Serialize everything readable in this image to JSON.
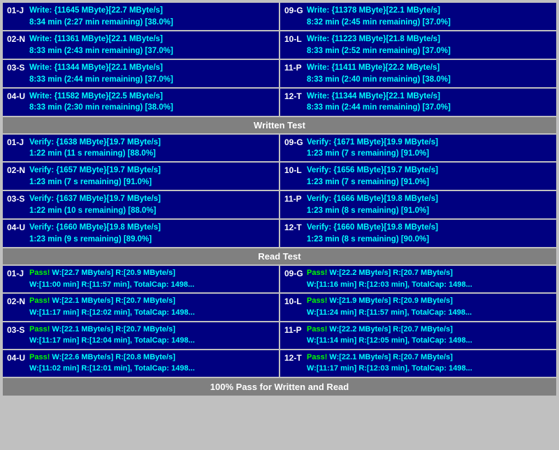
{
  "sections": {
    "write_test": {
      "header": "Written Test",
      "left_cells": [
        {
          "id": "01-J",
          "line1": "Write: {11645 MByte}[22.7 MByte/s]",
          "line2": "8:34 min (2:27 min remaining)  [38.0%]"
        },
        {
          "id": "02-N",
          "line1": "Write: {11361 MByte}[22.1 MByte/s]",
          "line2": "8:33 min (2:43 min remaining)  [37.0%]"
        },
        {
          "id": "03-S",
          "line1": "Write: {11344 MByte}[22.1 MByte/s]",
          "line2": "8:33 min (2:44 min remaining)  [37.0%]"
        },
        {
          "id": "04-U",
          "line1": "Write: {11582 MByte}[22.5 MByte/s]",
          "line2": "8:33 min (2:30 min remaining)  [38.0%]"
        }
      ],
      "right_cells": [
        {
          "id": "09-G",
          "line1": "Write: {11378 MByte}[22.1 MByte/s]",
          "line2": "8:32 min (2:45 min remaining)  [37.0%]"
        },
        {
          "id": "10-L",
          "line1": "Write: {11223 MByte}[21.8 MByte/s]",
          "line2": "8:33 min (2:52 min remaining)  [37.0%]"
        },
        {
          "id": "11-P",
          "line1": "Write: {11411 MByte}[22.2 MByte/s]",
          "line2": "8:33 min (2:40 min remaining)  [38.0%]"
        },
        {
          "id": "12-T",
          "line1": "Write: {11344 MByte}[22.1 MByte/s]",
          "line2": "8:33 min (2:44 min remaining)  [37.0%]"
        }
      ]
    },
    "verify_test": {
      "left_cells": [
        {
          "id": "01-J",
          "line1": "Verify: {1638 MByte}[19.7 MByte/s]",
          "line2": "1:22 min (11 s remaining)   [88.0%]"
        },
        {
          "id": "02-N",
          "line1": "Verify: {1657 MByte}[19.7 MByte/s]",
          "line2": "1:23 min (7 s remaining)   [91.0%]"
        },
        {
          "id": "03-S",
          "line1": "Verify: {1637 MByte}[19.7 MByte/s]",
          "line2": "1:22 min (10 s remaining)   [88.0%]"
        },
        {
          "id": "04-U",
          "line1": "Verify: {1660 MByte}[19.8 MByte/s]",
          "line2": "1:23 min (9 s remaining)   [89.0%]"
        }
      ],
      "right_cells": [
        {
          "id": "09-G",
          "line1": "Verify: {1671 MByte}[19.9 MByte/s]",
          "line2": "1:23 min (7 s remaining)   [91.0%]"
        },
        {
          "id": "10-L",
          "line1": "Verify: {1656 MByte}[19.7 MByte/s]",
          "line2": "1:23 min (7 s remaining)   [91.0%]"
        },
        {
          "id": "11-P",
          "line1": "Verify: {1666 MByte}[19.8 MByte/s]",
          "line2": "1:23 min (8 s remaining)   [91.0%]"
        },
        {
          "id": "12-T",
          "line1": "Verify: {1660 MByte}[19.8 MByte/s]",
          "line2": "1:23 min (8 s remaining)   [90.0%]"
        }
      ]
    },
    "read_test": {
      "header": "Read Test",
      "left_cells": [
        {
          "id": "01-J",
          "pass": "Pass!",
          "line1": "W:[22.7 MByte/s] R:[20.9 MByte/s]",
          "line2": "W:[11:00 min] R:[11:57 min], TotalCap: 1498..."
        },
        {
          "id": "02-N",
          "pass": "Pass!",
          "line1": "W:[22.1 MByte/s] R:[20.7 MByte/s]",
          "line2": "W:[11:17 min] R:[12:02 min], TotalCap: 1498..."
        },
        {
          "id": "03-S",
          "pass": "Pass!",
          "line1": "W:[22.1 MByte/s] R:[20.7 MByte/s]",
          "line2": "W:[11:17 min] R:[12:04 min], TotalCap: 1498..."
        },
        {
          "id": "04-U",
          "pass": "Pass!",
          "line1": "W:[22.6 MByte/s] R:[20.8 MByte/s]",
          "line2": "W:[11:02 min] R:[12:01 min], TotalCap: 1498..."
        }
      ],
      "right_cells": [
        {
          "id": "09-G",
          "pass": "Pass!",
          "line1": "W:[22.2 MByte/s] R:[20.7 MByte/s]",
          "line2": "W:[11:16 min] R:[12:03 min], TotalCap: 1498..."
        },
        {
          "id": "10-L",
          "pass": "Pass!",
          "line1": "W:[21.9 MByte/s] R:[20.9 MByte/s]",
          "line2": "W:[11:24 min] R:[11:57 min], TotalCap: 1498..."
        },
        {
          "id": "11-P",
          "pass": "Pass!",
          "line1": "W:[22.2 MByte/s] R:[20.7 MByte/s]",
          "line2": "W:[11:14 min] R:[12:05 min], TotalCap: 1498..."
        },
        {
          "id": "12-T",
          "pass": "Pass!",
          "line1": "W:[22.1 MByte/s] R:[20.7 MByte/s]",
          "line2": "W:[11:17 min] R:[12:03 min], TotalCap: 1498..."
        }
      ]
    }
  },
  "headers": {
    "written_test": "Written Test",
    "read_test": "Read Test"
  },
  "footer": "100% Pass for Written and Read"
}
